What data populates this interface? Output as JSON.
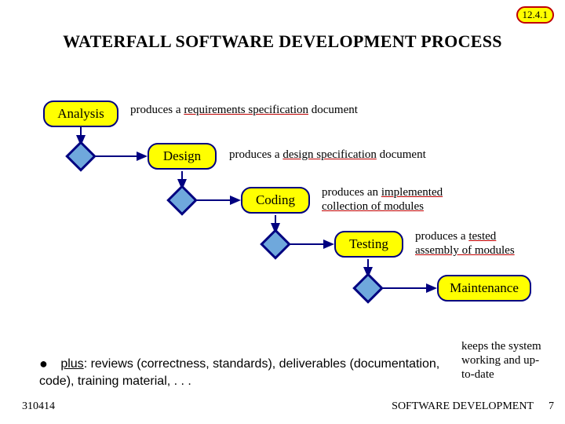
{
  "slide_number": "12.4.1",
  "title": "WATERFALL SOFTWARE DEVELOPMENT PROCESS",
  "stages": {
    "analysis": {
      "label": "Analysis",
      "prefix": "produces a ",
      "underlined": "requirements specification",
      "suffix": " document"
    },
    "design": {
      "label": "Design",
      "prefix": "produces a ",
      "underlined": "design specification",
      "suffix": " document"
    },
    "coding": {
      "label": "Coding",
      "prefix": "produces an ",
      "underlined": "implemented collection of modules",
      "suffix": ""
    },
    "testing": {
      "label": "Testing",
      "prefix": "produces a ",
      "underlined": "tested assembly of modules",
      "suffix": ""
    },
    "maintenance": {
      "label": "Maintenance",
      "desc": "keeps the system working and up-to-date"
    }
  },
  "plus": {
    "label": "plus",
    "text": ": reviews (correctness, standards), deliverables (documentation, code), training material, . . ."
  },
  "footer": {
    "left": "310414",
    "right": "SOFTWARE DEVELOPMENT",
    "page": "7"
  }
}
